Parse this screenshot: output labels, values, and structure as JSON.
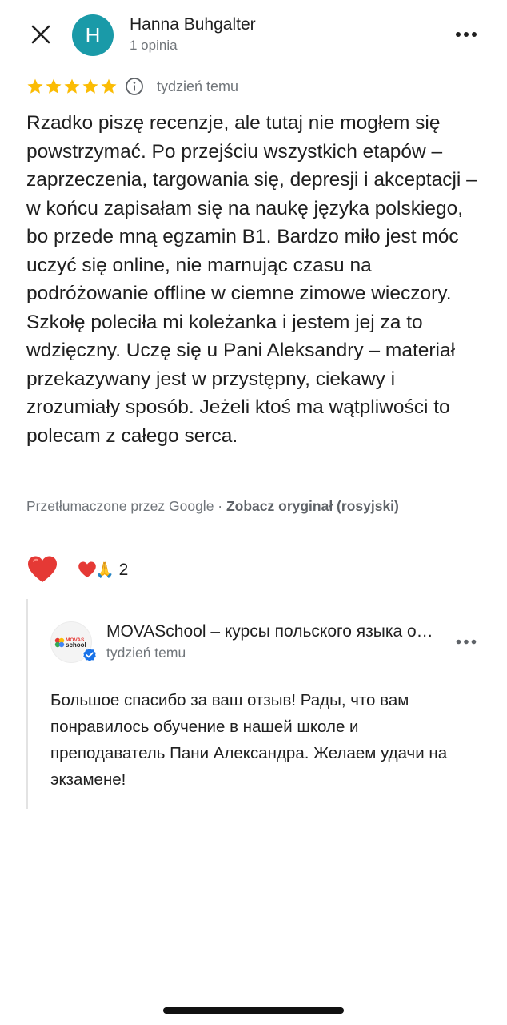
{
  "header": {
    "avatar_letter": "H",
    "avatar_color": "#1a9aa8",
    "author_name": "Hanna Buhgalter",
    "author_reviews": "1 opinia",
    "close_icon": "close-icon",
    "more_icon": "more-horizontal-icon"
  },
  "review": {
    "rating": 5,
    "star_color": "#fbbc04",
    "time": "tydzień temu",
    "text": "Rzadko piszę recenzje, ale tutaj nie mogłem się powstrzymać. Po przejściu wszystkich etapów – zaprzeczenia, targowania się, depresji i akceptacji – w końcu zapisałam się na naukę języka polskiego, bo przede mną egzamin B1. Bardzo miło jest móc uczyć się online, nie marnując czasu na podróżowanie offline w ciemne zimowe wieczory. Szkołę poleciła mi koleżanka i jestem jej za to wdzięczny. Uczę się u Pani Aleksandry – materiał przekazywany jest w przystępny, ciekawy i zrozumiały sposób. Jeżeli ktoś ma wątpliwości to polecam z całego serca.",
    "translated_by": "Przetłumaczone przez Google · ",
    "see_original": "Zobacz oryginał (rosyjski)"
  },
  "reactions": {
    "heart_color": "#e53935",
    "pray_emoji": "🙏",
    "count": "2"
  },
  "reply": {
    "logo_text_top": "MOVAS",
    "logo_text_bottom": "school",
    "owner_name": "MOVASchool – курсы польского языка онлайн",
    "time": "tydzień temu",
    "text": "Большое спасибо за ваш отзыв! Рады, что вам понравилось обучение в нашей школе и преподаватель Пани Александра. Желаем удачи на экзамене!",
    "verified_color": "#1a73e8"
  }
}
